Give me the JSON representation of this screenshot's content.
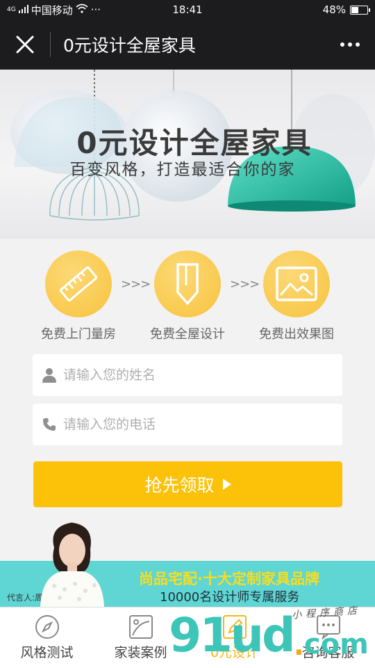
{
  "status_bar": {
    "network": "4G",
    "carrier": "中国移动",
    "dots": "···",
    "time": "18:41",
    "battery_percent": "48%",
    "battery_level": 0.48
  },
  "nav": {
    "title": "0元设计全屋家具"
  },
  "hero": {
    "title": "0元设计全屋家具",
    "subtitle": "百变风格，打造最适合你的家"
  },
  "steps": [
    {
      "label": "免费上门量房",
      "icon": "ruler-icon"
    },
    {
      "label": "免费全屋设计",
      "icon": "pencil-icon"
    },
    {
      "label": "免费出效果图",
      "icon": "image-icon"
    }
  ],
  "step_arrow": ">>>",
  "form": {
    "name_placeholder": "请输入您的姓名",
    "phone_placeholder": "请输入您的电话",
    "submit_label": "抢先领取"
  },
  "brand": {
    "line1": "尚品宅配·十大定制家具品牌",
    "line2": "10000名设计师专属服务",
    "spokesperson": "代言人:周迅"
  },
  "tabs": [
    {
      "label": "风格测试",
      "icon": "compass-icon",
      "active": false
    },
    {
      "label": "家装案例",
      "icon": "picture-frame-icon",
      "active": false
    },
    {
      "label": "0元设计",
      "icon": "design-pencil-icon",
      "active": true
    },
    {
      "label": "咨询客服",
      "icon": "chat-icon",
      "active": false
    }
  ],
  "watermark": {
    "main": "91ud",
    "dot": ".",
    "tld": "com",
    "small": "小程序商店"
  },
  "colors": {
    "accent_yellow": "#fcc20a",
    "brand_teal": "#5fd6d3",
    "step_yellow": "#f7c33d",
    "dark_bar": "#1c1c1f"
  }
}
